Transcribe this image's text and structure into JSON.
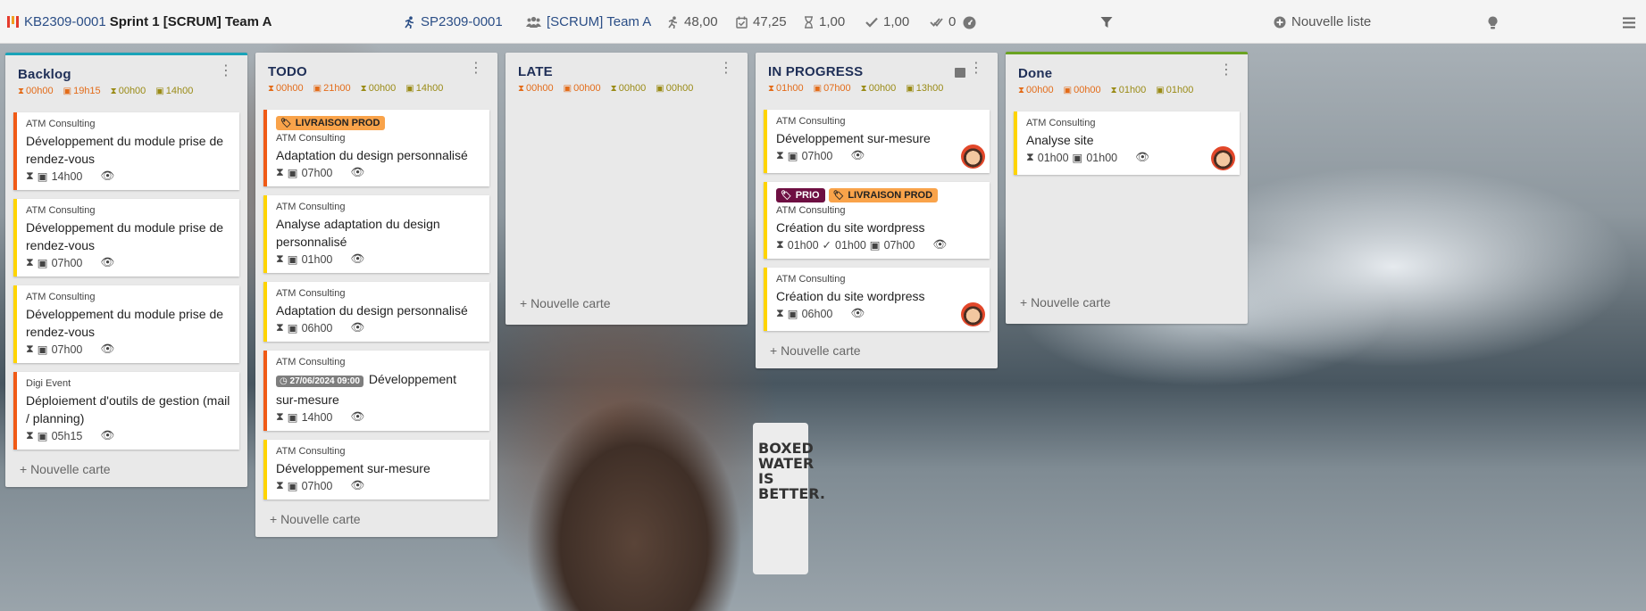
{
  "topbar": {
    "board_ref": "KB2309-0001",
    "board_title": "Sprint 1 [SCRUM] Team A",
    "sprint_ref": "SP2309-0001",
    "team": "[SCRUM] Team A",
    "stat_run": "48,00",
    "stat_planned": "47,25",
    "stat_hourglass": "1,00",
    "stat_check": "1,00",
    "stat_done": "0",
    "new_list": "Nouvelle liste"
  },
  "columns": [
    {
      "title": "Backlog",
      "stats": [
        "00h00",
        "19h15",
        "00h00",
        "14h00"
      ],
      "add_label": "+ Nouvelle carte",
      "cards": [
        {
          "client": "ATM Consulting",
          "title": "Développement du module prise de rendez-vous",
          "time": "14h00"
        },
        {
          "client": "ATM Consulting",
          "title": "Développement du module prise de rendez-vous",
          "time": "07h00"
        },
        {
          "client": "ATM Consulting",
          "title": "Développement du module prise de rendez-vous",
          "time": "07h00"
        },
        {
          "client": "Digi Event",
          "title": "Déploiement d'outils de gestion (mail / planning)",
          "time": "05h15"
        }
      ]
    },
    {
      "title": "TODO",
      "stats": [
        "00h00",
        "21h00",
        "00h00",
        "14h00"
      ],
      "add_label": "+ Nouvelle carte",
      "cards": [
        {
          "tag": "LIVRAISON PROD",
          "client": "ATM Consulting",
          "title": "Adaptation du design personnalisé",
          "time": "07h00"
        },
        {
          "client": "ATM Consulting",
          "title": "Analyse adaptation du design personnalisé",
          "time": "01h00"
        },
        {
          "client": "ATM Consulting",
          "title": "Adaptation du design personnalisé",
          "time": "06h00"
        },
        {
          "client": "ATM Consulting",
          "date": "27/06/2024 09:00",
          "title": "Développement sur-mesure",
          "time": "14h00"
        },
        {
          "client": "ATM Consulting",
          "title": "Développement sur-mesure",
          "time": "07h00"
        }
      ]
    },
    {
      "title": "LATE",
      "stats": [
        "00h00",
        "00h00",
        "00h00",
        "00h00"
      ],
      "add_label": "+ Nouvelle carte"
    },
    {
      "title": "IN PROGRESS",
      "stats": [
        "01h00",
        "07h00",
        "00h00",
        "13h00"
      ],
      "add_label": "+ Nouvelle carte",
      "cards": [
        {
          "client": "ATM Consulting",
          "title": "Développement sur-mesure",
          "time": "07h00"
        },
        {
          "tag1": "PRIO",
          "tag2": "LIVRAISON PROD",
          "client": "ATM Consulting",
          "title": "Création du site wordpress",
          "spent": "01h00",
          "done": "01h00",
          "time": "07h00"
        },
        {
          "client": "ATM Consulting",
          "title": "Création du site wordpress",
          "time": "06h00"
        }
      ]
    },
    {
      "title": "Done",
      "stats": [
        "00h00",
        "00h00",
        "01h00",
        "01h00"
      ],
      "add_label": "+ Nouvelle carte",
      "cards": [
        {
          "client": "ATM Consulting",
          "title": "Analyse site",
          "spent": "01h00",
          "time": "01h00"
        }
      ]
    }
  ],
  "colors": {
    "accent_blue": "#2b4e86",
    "card_yellow": "#ffd400",
    "card_red": "#f05a16",
    "backlog_top": "#1aa3b8",
    "done_top": "#6aa322"
  },
  "background_text": "BOXED WATER IS BETTER."
}
